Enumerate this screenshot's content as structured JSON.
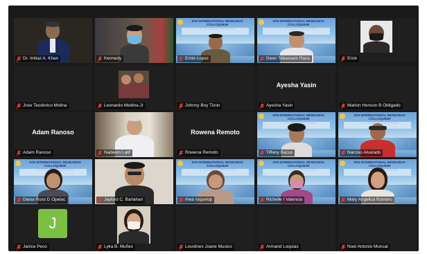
{
  "participants": [
    {
      "name": "Dr. Imtiaz A. Khan",
      "view": "video"
    },
    {
      "name": "Kennedy",
      "view": "video"
    },
    {
      "name": "Ernie Lopez",
      "view": "video"
    },
    {
      "name": "Dean Tabassam Raza",
      "view": "video"
    },
    {
      "name": "Erick",
      "view": "video"
    },
    {
      "name": "Jose Teodorico Molina",
      "view": "camera-off"
    },
    {
      "name": "Leonardo Medina Jr",
      "view": "video"
    },
    {
      "name": "Johnny Boy Tizon",
      "view": "camera-off"
    },
    {
      "name": "Ayesha Yasin",
      "view": "name-card",
      "card_text": "Ayesha Yasin"
    },
    {
      "name": "Marlon Henson B Obligado",
      "view": "camera-off"
    },
    {
      "name": "Adam Ranoso",
      "view": "name-card",
      "card_text": "Adam Ranoso"
    },
    {
      "name": "Nadeem Latif",
      "view": "video"
    },
    {
      "name": "Rowena Remoto",
      "view": "name-card",
      "card_text": "Rowena Remoto"
    },
    {
      "name": "Tiffany Bacus",
      "view": "video"
    },
    {
      "name": "Narciso Alvarado",
      "view": "video"
    },
    {
      "name": "Diana Ross D Opelac",
      "view": "video"
    },
    {
      "name": "Jaylord C. Barlahan",
      "view": "video"
    },
    {
      "name": "rhea roquelop",
      "view": "video"
    },
    {
      "name": "Richelle I Valencia",
      "view": "video"
    },
    {
      "name": "Mary Angelica Romero",
      "view": "video"
    },
    {
      "name": "Janice Peco",
      "view": "avatar",
      "avatar_letter": "J"
    },
    {
      "name": "Lyka B. Muñez",
      "view": "video"
    },
    {
      "name": "Lourdnes Joane Musico",
      "view": "camera-off"
    },
    {
      "name": "Armand Loquias",
      "view": "camera-off"
    },
    {
      "name": "Noel Antonio Muncal",
      "view": "camera-off"
    }
  ],
  "banner_text": {
    "line1": "6TH INTERNATIONAL RESEARCH COLLOQUIUM",
    "line2": "& TRAINING PROGRAM"
  },
  "colors": {
    "muted_mic": "#e53935",
    "active_speaker": "#d6e84a",
    "avatar_bg": "#7bc043",
    "tile_bg": "#1f1f1f"
  },
  "active_speaker": "Ernie Lopez"
}
